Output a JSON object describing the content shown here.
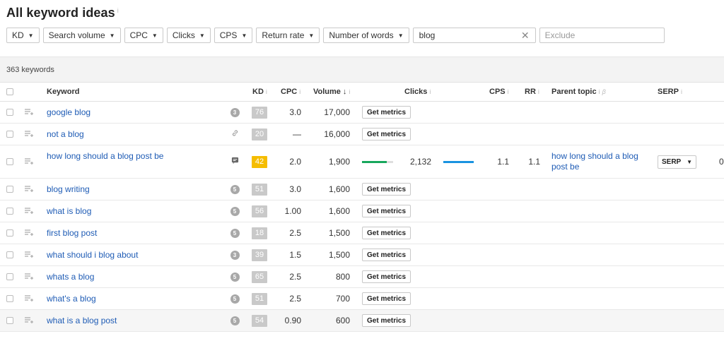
{
  "page": {
    "title": "All keyword ideas",
    "title_info": "i"
  },
  "filters": [
    {
      "label": "KD"
    },
    {
      "label": "Search volume"
    },
    {
      "label": "CPC"
    },
    {
      "label": "Clicks"
    },
    {
      "label": "CPS"
    },
    {
      "label": "Return rate"
    },
    {
      "label": "Number of words"
    }
  ],
  "search": {
    "value": "blog",
    "clear_icon": "close-icon"
  },
  "exclude": {
    "placeholder": "Exclude"
  },
  "summary": {
    "count_text": "363 keywords"
  },
  "columns": {
    "keyword": "Keyword",
    "kd": "KD",
    "cpc": "CPC",
    "volume": "Volume",
    "clicks": "Clicks",
    "cps": "CPS",
    "rr": "RR",
    "parent_topic": "Parent topic",
    "parent_topic_beta": "β",
    "serp": "SERP",
    "info": "i",
    "sort_arrow": "↓"
  },
  "get_metrics_label": "Get metrics",
  "rows": [
    {
      "keyword": "google blog",
      "icon": "3",
      "kd": "76",
      "cpc": "3.0",
      "volume": "17,000"
    },
    {
      "keyword": "not a blog",
      "icon": "link-icon",
      "kd": "20",
      "cpc": "—",
      "volume": "16,000"
    },
    {
      "keyword": "how long should a blog post be",
      "icon": "featured-snippet-icon",
      "kd": "42",
      "kd_color": "#f5bd00",
      "cpc": "2.0",
      "volume": "1,900",
      "clicks": "2,132",
      "clicks_paid_fraction": 0.8,
      "cps": "1.1",
      "rr": "1.1",
      "parent_topic": "how long should a blog post be",
      "serp_label": "SERP",
      "extra": "0"
    },
    {
      "keyword": "blog writing",
      "icon": "5",
      "kd": "51",
      "cpc": "3.0",
      "volume": "1,600"
    },
    {
      "keyword": "what is blog",
      "icon": "5",
      "kd": "56",
      "cpc": "1.00",
      "volume": "1,600"
    },
    {
      "keyword": "first blog post",
      "icon": "5",
      "kd": "18",
      "cpc": "2.5",
      "volume": "1,500"
    },
    {
      "keyword": "what should i blog about",
      "icon": "3",
      "kd": "39",
      "cpc": "1.5",
      "volume": "1,500"
    },
    {
      "keyword": "whats a blog",
      "icon": "5",
      "kd": "65",
      "cpc": "2.5",
      "volume": "800"
    },
    {
      "keyword": "what's a blog",
      "icon": "5",
      "kd": "51",
      "cpc": "2.5",
      "volume": "700"
    },
    {
      "keyword": "what is a blog post",
      "icon": "5",
      "kd": "54",
      "cpc": "0.90",
      "volume": "600"
    }
  ]
}
